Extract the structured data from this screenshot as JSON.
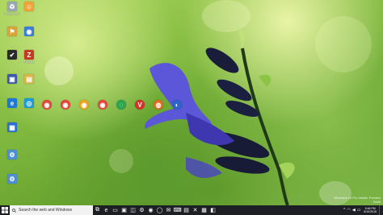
{
  "desktop": {
    "icons": [
      {
        "name": "recycle-bin-icon",
        "label": "Recycle Bin",
        "symbol": "♻",
        "color": "#9aa7b2"
      },
      {
        "name": "app-icon-r1c2",
        "label": "",
        "symbol": "☺",
        "color": "#f0a23b"
      },
      {
        "name": "app-icon-r2c1",
        "label": "",
        "symbol": "⚑",
        "color": "#d7a43a"
      },
      {
        "name": "app-icon-r2c2",
        "label": "",
        "symbol": "◉",
        "color": "#3b7dd8"
      },
      {
        "name": "app-icon-r3c1",
        "label": "",
        "symbol": "✔",
        "color": "#2a2a2a"
      },
      {
        "name": "filezilla-icon",
        "label": "FileZilla",
        "symbol": "Z",
        "color": "#c43b24"
      },
      {
        "name": "app-icon-r4c1",
        "label": "",
        "symbol": "▣",
        "color": "#3b5aa8"
      },
      {
        "name": "app-icon-r4c2",
        "label": "",
        "symbol": "▤",
        "color": "#d9b54a"
      },
      {
        "name": "edge-icon",
        "label": "",
        "symbol": "e",
        "color": "#1e78d6"
      },
      {
        "name": "app-icon-r5c2",
        "label": "",
        "symbol": "◎",
        "color": "#1c9bd7"
      },
      {
        "name": "app-icon-r6c1",
        "label": "",
        "symbol": "▦",
        "color": "#2a6fd1"
      },
      {
        "name": "app-icon-r7c1",
        "label": "",
        "symbol": "⚙",
        "color": "#4c8fd8"
      },
      {
        "name": "app-icon-r8c1",
        "label": "",
        "symbol": "⚙",
        "color": "#4c8fd8"
      }
    ],
    "browser_row": [
      {
        "name": "chrome-icon-1",
        "symbol": "◉",
        "color": "#e8453c"
      },
      {
        "name": "chrome-icon-2",
        "symbol": "◉",
        "color": "#e8453c"
      },
      {
        "name": "chrome-canary-icon",
        "symbol": "◉",
        "color": "#f1a51d"
      },
      {
        "name": "chrome-icon-3",
        "symbol": "◉",
        "color": "#e8453c"
      },
      {
        "name": "app-icon-green-ring",
        "symbol": "◌",
        "color": "#2ea44f"
      },
      {
        "name": "vivaldi-icon",
        "symbol": "V",
        "color": "#d6322c"
      },
      {
        "name": "firefox-icon",
        "symbol": "◍",
        "color": "#e66a1f"
      },
      {
        "name": "app-icon-blue-globe",
        "symbol": "◐",
        "color": "#2d64c8"
      }
    ]
  },
  "watermark": {
    "line1": "Windows 10 Pro Insider Preview",
    "line2": "Build"
  },
  "taskbar": {
    "search_placeholder": "Search the web and Windows",
    "pinned": [
      {
        "name": "task-view-icon",
        "symbol": "⧉"
      },
      {
        "name": "edge-taskbar-icon",
        "symbol": "e"
      },
      {
        "name": "explorer-taskbar-icon",
        "symbol": "▭"
      },
      {
        "name": "store-taskbar-icon",
        "symbol": "▣"
      },
      {
        "name": "taskbar-app-4",
        "symbol": "◫"
      },
      {
        "name": "taskbar-app-5",
        "symbol": "⚙"
      },
      {
        "name": "taskbar-app-6",
        "symbol": "◉"
      },
      {
        "name": "taskbar-app-7",
        "symbol": "◯"
      },
      {
        "name": "taskbar-app-8",
        "symbol": "✉"
      },
      {
        "name": "taskbar-app-9",
        "symbol": "⌨"
      },
      {
        "name": "taskbar-app-10",
        "symbol": "▤"
      },
      {
        "name": "taskbar-app-11",
        "symbol": "✕"
      },
      {
        "name": "taskbar-app-12",
        "symbol": "▦"
      },
      {
        "name": "taskbar-app-13",
        "symbol": "◧"
      }
    ],
    "tray": [
      {
        "name": "up-arrow-icon",
        "symbol": "^"
      },
      {
        "name": "network-icon",
        "symbol": "◠"
      },
      {
        "name": "volume-icon",
        "symbol": "◀"
      },
      {
        "name": "language-icon",
        "symbol": "▭"
      }
    ],
    "time": "6:46 PM",
    "date": "8/10/2015"
  }
}
